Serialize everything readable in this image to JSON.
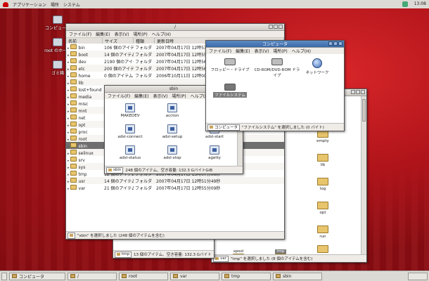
{
  "topbar": {
    "applications": "アプリケーション",
    "places": "場所",
    "system": "システム",
    "clock": "13:08"
  },
  "desktop_icons": [
    "コンピュータ",
    "root のホーム",
    "ゴミ箱"
  ],
  "root_window": {
    "title": "/",
    "menu": [
      "ファイル(F)",
      "編集(E)",
      "表示(V)",
      "場所(P)",
      "ヘルプ(H)"
    ],
    "columns": [
      "名前",
      "サイズ",
      "種類",
      "更新日時"
    ],
    "rows": [
      {
        "name": "bin",
        "size": "106 個のアイテム",
        "type": "フォルダ",
        "date": "2007年04月17日 12時53分05秒"
      },
      {
        "name": "boot",
        "size": "14 個のアイテム",
        "type": "フォルダ",
        "date": "2007年04月17日 12時55分09秒"
      },
      {
        "name": "dev",
        "size": "2190 個のアイテム",
        "type": "フォルダ",
        "date": "2007年04月17日 12時56分15秒"
      },
      {
        "name": "etc",
        "size": "200 個のアイテム",
        "type": "フォルダ",
        "date": "2007年04月17日 12時56分11秒"
      },
      {
        "name": "home",
        "size": "0 個のアイテム",
        "type": "フォルダ",
        "date": "2006年10月11日 12時00分37秒"
      },
      {
        "name": "lib",
        "size": "",
        "type": "",
        "date": ""
      },
      {
        "name": "lost+found",
        "size": "",
        "type": "",
        "date": ""
      },
      {
        "name": "media",
        "size": "",
        "type": "",
        "date": ""
      },
      {
        "name": "misc",
        "size": "",
        "type": "",
        "date": ""
      },
      {
        "name": "mnt",
        "size": "",
        "type": "",
        "date": ""
      },
      {
        "name": "net",
        "size": "",
        "type": "",
        "date": ""
      },
      {
        "name": "opt",
        "size": "",
        "type": "",
        "date": ""
      },
      {
        "name": "proc",
        "size": "",
        "type": "",
        "date": ""
      },
      {
        "name": "root",
        "size": "",
        "type": "",
        "date": ""
      },
      {
        "name": "sbin",
        "size": "248",
        "type": "",
        "date": ""
      },
      {
        "name": "selinux",
        "size": "",
        "type": "",
        "date": ""
      },
      {
        "name": "srv",
        "size": "",
        "type": "",
        "date": ""
      },
      {
        "name": "sys",
        "size": "",
        "type": "",
        "date": ""
      },
      {
        "name": "tmp",
        "size": "12 個のアイテム",
        "type": "フォルダ",
        "date": "2007年04月17日 13時07分06秒"
      },
      {
        "name": "usr",
        "size": "14 個のアイテム",
        "type": "フォルダ",
        "date": "2007年04月17日 12時51分49秒"
      },
      {
        "name": "var",
        "size": "21 個のアイテム",
        "type": "フォルダ",
        "date": "2007年04月17日 12時55分09秒"
      }
    ],
    "status": "\"sbin\" を選択しました (248 個のアイテムを含む)"
  },
  "computer_window": {
    "title": "コンピュータ",
    "menu": [
      "ファイル(F)",
      "編集(E)",
      "表示(V)",
      "場所(P)",
      "ヘルプ(H)"
    ],
    "items": [
      "フロッピー・ドライブ",
      "CD-ROM/DVD-ROM ドライブ",
      "ネットワーク",
      "ファイルシステム"
    ],
    "path": "コンピュータ",
    "status": "\"ファイルシステム\" を選択しました (0 バイト)"
  },
  "sbin_window": {
    "title": "sbin",
    "menu": [
      "ファイル(F)",
      "編集(E)",
      "表示(V)",
      "場所(P)",
      "ヘルプ(H)"
    ],
    "items": [
      "MAKEDEV",
      "accton",
      "adsl-connect",
      "adsl-setup",
      "adsl-start",
      "adsl-status",
      "adsl-stop",
      "agetty"
    ],
    "path": "sbin",
    "status": "248 個のアイテム、空き容量: 132.3 GバイトGiB"
  },
  "var_window": {
    "items": [
      "empty",
      "lib",
      "log",
      "opt",
      "run",
      "tux",
      "spool",
      "tmp"
    ],
    "path": "var",
    "status": "\"tmp\" を選択しました (8 個のアイテムを含む)"
  },
  "tmp_window": {
    "path": "tmp",
    "status": "13 個のアイテム、空き容量: 132.3 Gバイト"
  },
  "taskbar": [
    "コンピュータ",
    "/",
    "root",
    "var",
    "tmp",
    "sbin"
  ]
}
